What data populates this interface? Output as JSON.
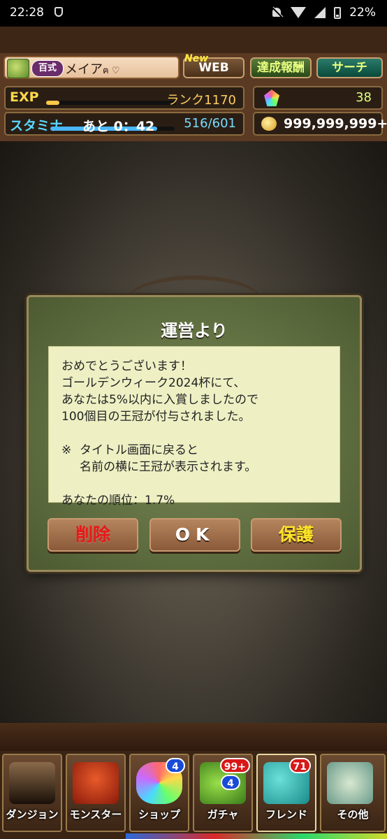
{
  "status_bar": {
    "time": "22:28",
    "battery": "22%"
  },
  "header": {
    "badge_title": "百式",
    "player_name": "メイア",
    "name_suffix": "ฅ ♡",
    "new_tag": "New",
    "web_label": "WEB",
    "achievement_label": "達成報酬",
    "search_label": "サーチ",
    "exp_label": "EXP",
    "exp_progress": 0.1,
    "rank_text": "ランク1170",
    "stamina_label": "スタミナ",
    "stamina_progress": 0.86,
    "stamina_timer": "あと 0：42",
    "stamina_value": "516/601",
    "stones_value": "38",
    "coins_value": "999,999,999+"
  },
  "dialog": {
    "title": "運営より",
    "message_main": "おめでとうございます！\nゴールデンウィーク2024杯にて、\nあなたは5%以内に入賞しましたので\n100個目の王冠が付与されました。",
    "note_mark": "※",
    "message_note": "タイトル画面に戻ると\n名前の横に王冠が表示されます。",
    "rank_line": "あなたの順位：1.7%",
    "delete_label": "削除",
    "ok_label": "OK",
    "protect_label": "保護"
  },
  "nav": {
    "items": [
      {
        "label": "ダンジョン",
        "badge": ""
      },
      {
        "label": "モンスター",
        "badge": ""
      },
      {
        "label": "ショップ",
        "badge": "4"
      },
      {
        "label": "ガチャ",
        "badge": "99+",
        "badge2": "4"
      },
      {
        "label": "フレンド",
        "badge": "71"
      },
      {
        "label": "その他",
        "badge": ""
      }
    ]
  }
}
